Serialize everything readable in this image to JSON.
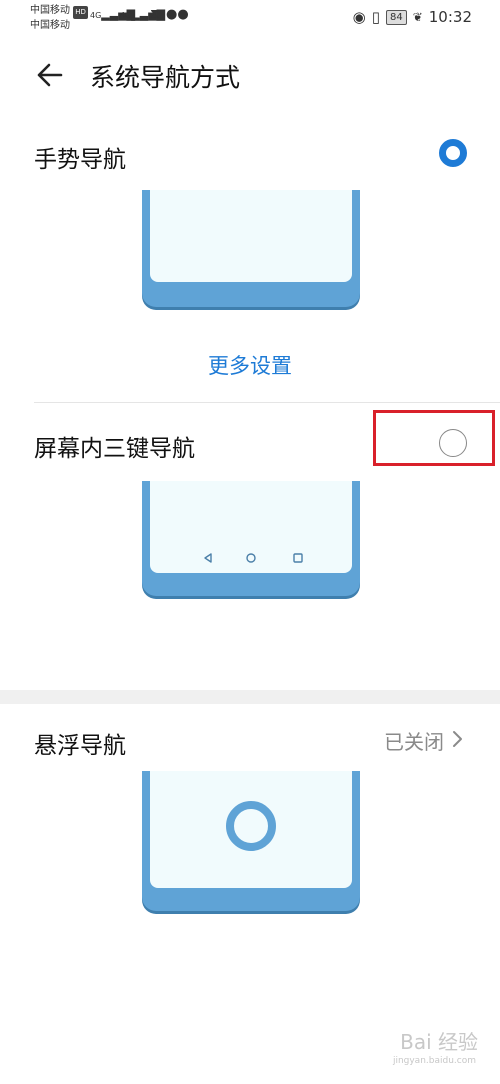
{
  "status_bar": {
    "carrier1": "中国移动",
    "carrier1_badge": "HD",
    "carrier2": "中国移动",
    "signal_label": "4G",
    "battery": "84",
    "time": "10:32"
  },
  "header": {
    "back_icon": "arrow-left-icon",
    "title": "系统导航方式"
  },
  "options": [
    {
      "label": "手势导航",
      "selected": true,
      "more_link": "更多设置"
    },
    {
      "label": "屏幕内三键导航",
      "selected": false
    },
    {
      "label": "悬浮导航",
      "status": "已关闭"
    }
  ],
  "colors": {
    "accent": "#1e7bd6",
    "phone_frame": "#5fa3d6",
    "phone_screen": "#f1fbfd",
    "highlight_box": "#d9202a"
  },
  "watermark": {
    "brand": "Bai 经验",
    "sub": "jingyan.baidu.com"
  }
}
